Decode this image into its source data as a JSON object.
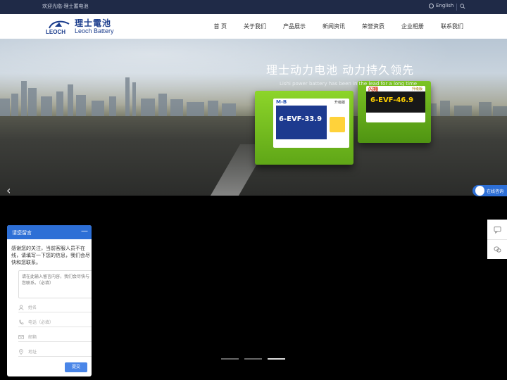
{
  "topbar": {
    "welcome": "欢迎光临-理士蓄电池",
    "language": "English",
    "language_icon": "globe-icon",
    "search_icon": "search-icon"
  },
  "header": {
    "logo_cn": "理士電池",
    "logo_en": "Leoch Battery",
    "logo_mark": "LEOCH"
  },
  "nav": {
    "items": [
      "首 页",
      "关于我们",
      "产品展示",
      "新闻资讯",
      "荣誉资质",
      "企业相册",
      "联系我们"
    ]
  },
  "banner": {
    "title": "理士动力电池 动力持久领先",
    "subtitle": "Lishi power battery has been in the lead for a long time",
    "battery1": {
      "brand": "M-B",
      "tag": "升级版",
      "model": "6-EVF-33.9"
    },
    "battery2": {
      "brand": "闪翔",
      "tag": "升级版",
      "model": "6-EVF-46.9"
    },
    "prev_icon": "chevron-left-icon"
  },
  "online_service": {
    "label": "在线咨询"
  },
  "side_tools": [
    "chat-icon",
    "wechat-icon"
  ],
  "carousel": {
    "slide_count": 3,
    "active_index": 2
  },
  "message_widget": {
    "title": "请您留言",
    "minimize": "—",
    "intro": "感谢您的关注，当前客服人员不在线，请填写一下您的信息，我们会尽快和您联系。",
    "textarea_placeholder": "请在此输入留言内容，我们会尽快与您联系。（必填）",
    "fields": [
      {
        "placeholder": "姓名",
        "icon": "user-icon"
      },
      {
        "placeholder": "电话（必填）",
        "icon": "phone-icon"
      },
      {
        "placeholder": "邮箱",
        "icon": "mail-icon"
      },
      {
        "placeholder": "地址",
        "icon": "location-icon"
      }
    ],
    "submit": "提交"
  },
  "colors": {
    "topbar": "#1f2a47",
    "brand_blue": "#1a3c8c",
    "widget_blue": "#2d6fd6"
  }
}
